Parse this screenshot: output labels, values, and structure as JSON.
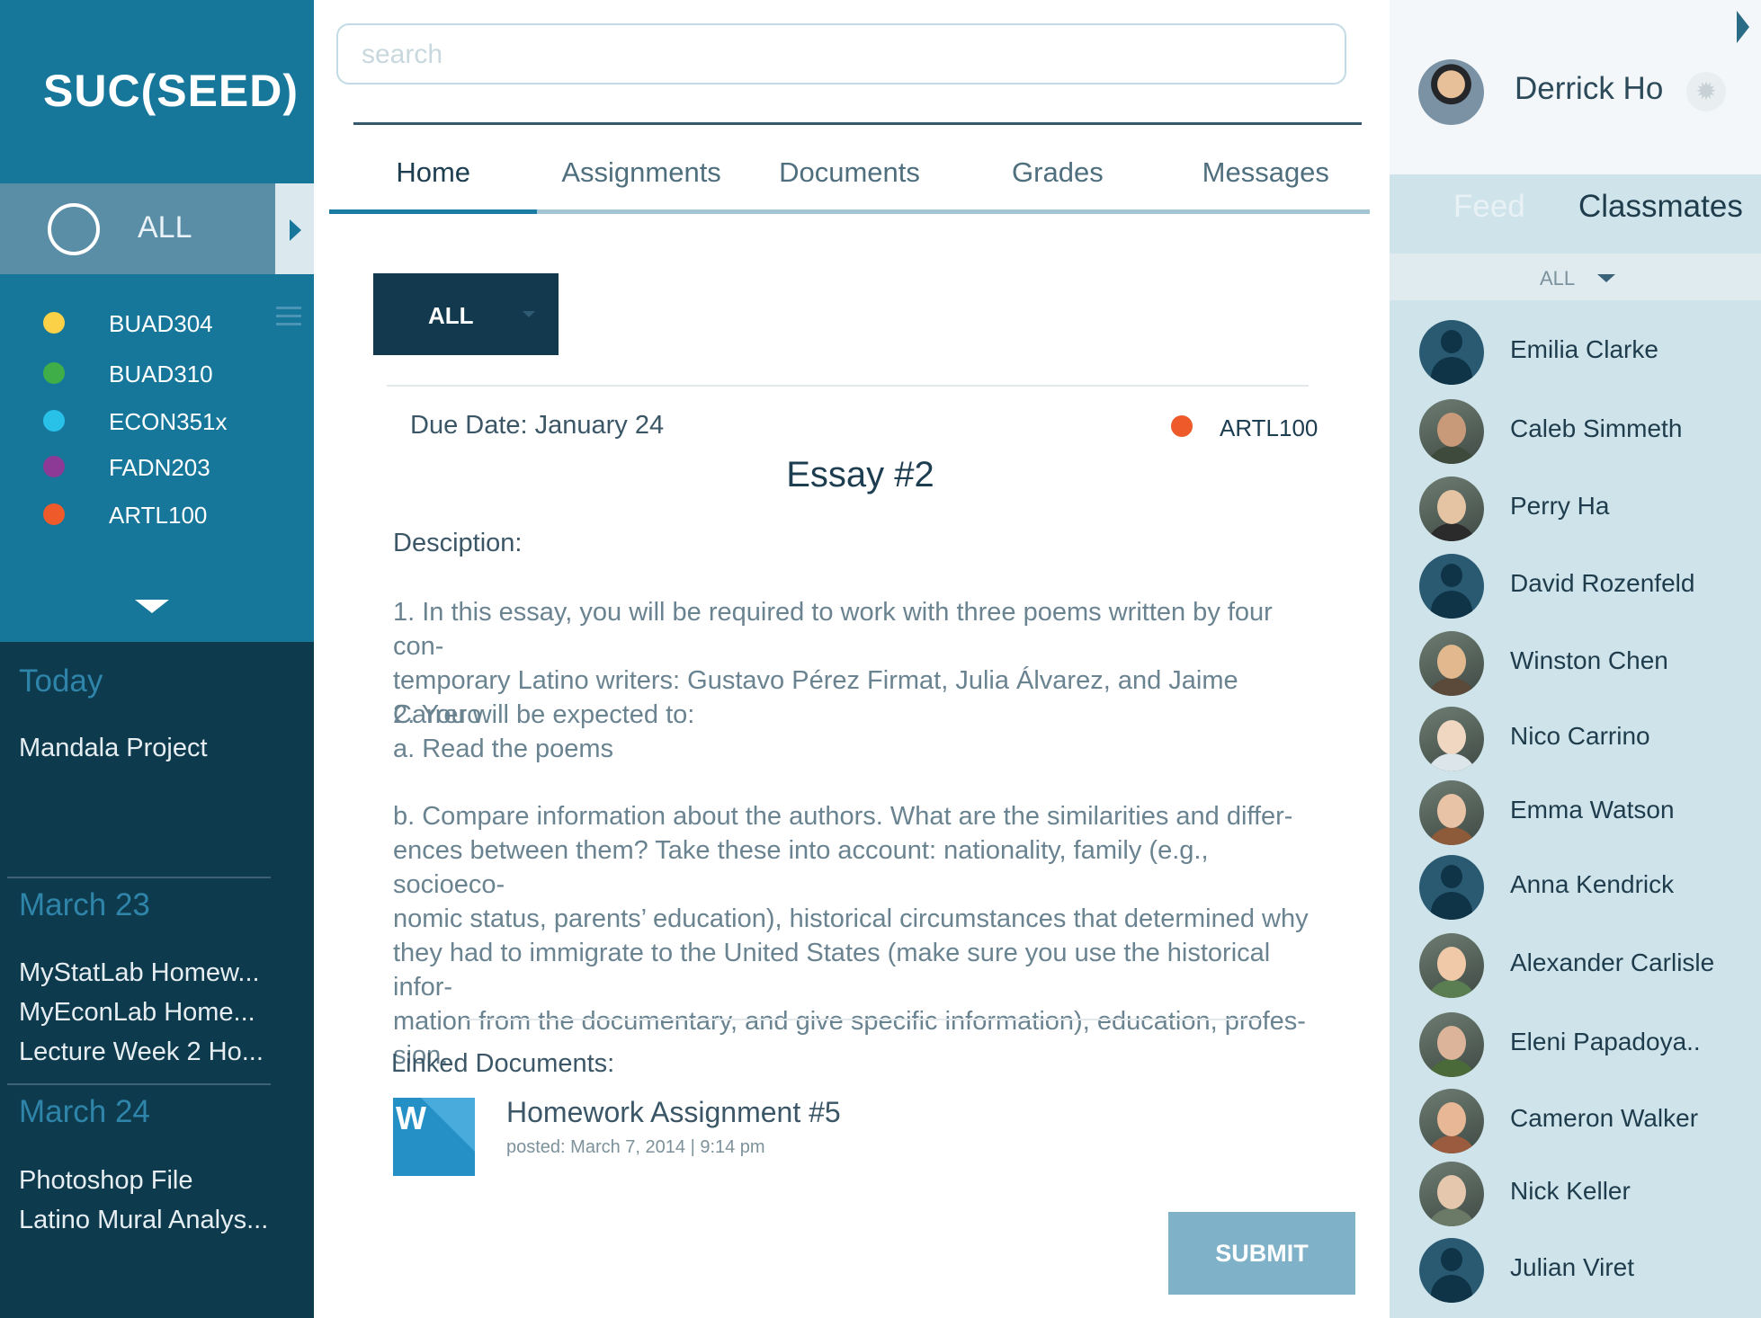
{
  "sidebar": {
    "brand": "SUC(SEED)",
    "all_label": "ALL",
    "courses": [
      {
        "code": "BUAD304",
        "color": "#fbd247"
      },
      {
        "code": "BUAD310",
        "color": "#3fae49"
      },
      {
        "code": "ECON351x",
        "color": "#28c1e8"
      },
      {
        "code": "FADN203",
        "color": "#8c3a96"
      },
      {
        "code": "ARTL100",
        "color": "#ee5a2a"
      }
    ],
    "schedule": [
      {
        "heading": "Today",
        "items": [
          "Mandala Project"
        ]
      },
      {
        "heading": "March 23",
        "items": [
          "MyStatLab Homew...",
          "MyEconLab Home...",
          "Lecture Week 2 Ho..."
        ]
      },
      {
        "heading": "March 24",
        "items": [
          "Photoshop File",
          "Latino Mural Analys..."
        ]
      }
    ]
  },
  "search": {
    "placeholder": "search"
  },
  "tabs": [
    "Home",
    "Assignments",
    "Documents",
    "Grades",
    "Messages"
  ],
  "active_tab": "Home",
  "filter": {
    "label": "ALL"
  },
  "assignment": {
    "due": "Due Date: January 24",
    "course": "ARTL100",
    "course_color": "#ee5a2a",
    "title": "Essay #2",
    "description_label": "Desciption:",
    "paragraphs": [
      "1. In this essay, you will be required to work with three poems written by four con-\ntemporary Latino writers: Gustavo Pérez Firmat, Julia Álvarez, and Jaime Carrero",
      "2. You will be expected to:\na. Read the poems",
      "b. Compare information about the authors. What are the similarities and differ-\nences between them? Take these into account: nationality, family (e.g., socioeco-\nnomic status, parents’ education), historical circumstances that determined why\nthey had to immigrate to the United States (make sure you use the historical infor-\nmation from the documentary, and give specific information), education, profes-\nsion."
    ],
    "linked_label": "Linked Documents:",
    "linked_doc": {
      "icon_letter": "W",
      "title": "Homework Assignment #5",
      "meta": "posted: March 7, 2014 | 9:14 pm"
    },
    "submit_label": "SUBMIT"
  },
  "profile": {
    "name": "Derrick Ho"
  },
  "right_tabs": {
    "feed": "Feed",
    "classmates": "Classmates"
  },
  "classmate_filter": "ALL",
  "classmates": [
    {
      "name": "Emilia Clarke",
      "avatar": "default"
    },
    {
      "name": "Caleb Simmeth",
      "avatar": "photo",
      "skin": "#c99a7a",
      "shirt": "#3e4a3c"
    },
    {
      "name": "Perry Ha",
      "avatar": "photo",
      "skin": "#e5c4a4",
      "shirt": "#2b2b2b"
    },
    {
      "name": "David Rozenfeld",
      "avatar": "default"
    },
    {
      "name": "Winston Chen",
      "avatar": "photo",
      "skin": "#e2b98f",
      "shirt": "#5b4a3a"
    },
    {
      "name": "Nico Carrino",
      "avatar": "photo",
      "skin": "#efd7c2",
      "shirt": "#dce6ea"
    },
    {
      "name": "Emma Watson",
      "avatar": "photo",
      "skin": "#e8c3a6",
      "shirt": "#8d5b3a"
    },
    {
      "name": "Anna Kendrick",
      "avatar": "default"
    },
    {
      "name": "Alexander Carlisle",
      "avatar": "photo",
      "skin": "#efc9a8",
      "shirt": "#5a7d52"
    },
    {
      "name": "Eleni Papadoya..",
      "avatar": "photo",
      "skin": "#dcb49a",
      "shirt": "#4b6a3a"
    },
    {
      "name": "Cameron Walker",
      "avatar": "photo",
      "skin": "#e8b796",
      "shirt": "#9a5b3e"
    },
    {
      "name": "Nick Keller",
      "avatar": "photo",
      "skin": "#e5c7ad",
      "shirt": "#6a7a66"
    },
    {
      "name": "Julian Viret",
      "avatar": "default"
    }
  ]
}
